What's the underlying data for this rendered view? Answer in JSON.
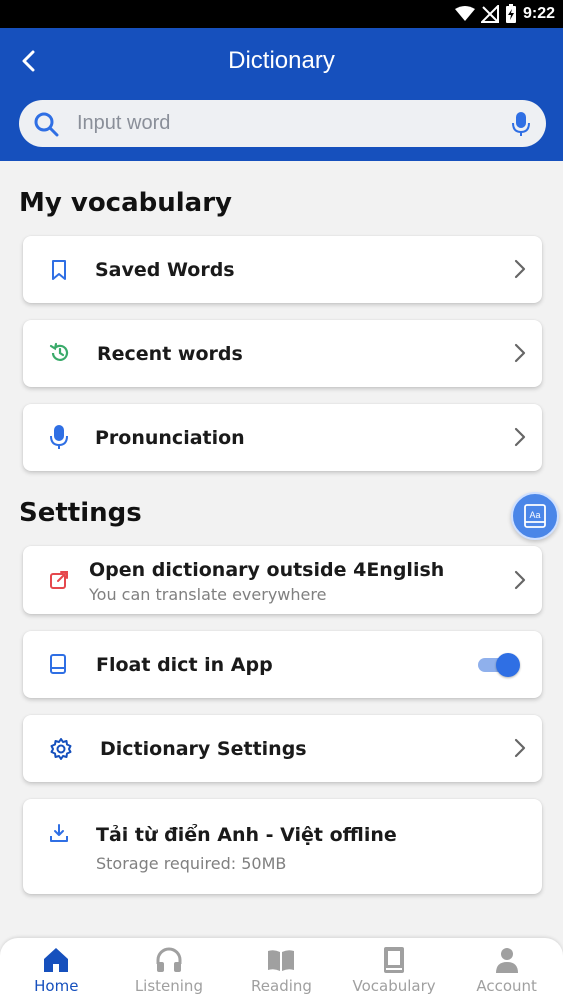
{
  "status_bar": {
    "time": "9:22"
  },
  "header": {
    "title": "Dictionary",
    "search_placeholder": "Input word"
  },
  "my_vocabulary": {
    "title": "My vocabulary",
    "items": [
      {
        "label": "Saved Words",
        "icon": "bookmark-icon"
      },
      {
        "label": "Recent words",
        "icon": "history-icon"
      },
      {
        "label": "Pronunciation",
        "icon": "microphone-icon"
      }
    ]
  },
  "settings": {
    "title": "Settings",
    "open_outside": {
      "label": "Open dictionary outside 4English",
      "sub": "You can translate everywhere",
      "icon": "open-external-icon"
    },
    "float_dict": {
      "label": "Float dict in App",
      "icon": "book-icon",
      "enabled": true
    },
    "dict_settings": {
      "label": "Dictionary Settings",
      "icon": "gear-icon"
    },
    "offline": {
      "label": "Tải từ điển Anh - Việt offline",
      "sub": "Storage required: 50MB",
      "icon": "download-icon"
    }
  },
  "float_button": {
    "text": "Aa"
  },
  "bottom_nav": {
    "items": [
      {
        "label": "Home",
        "icon": "home-icon",
        "active": true
      },
      {
        "label": "Listening",
        "icon": "headphones-icon",
        "active": false
      },
      {
        "label": "Reading",
        "icon": "open-book-icon",
        "active": false
      },
      {
        "label": "Vocabulary",
        "icon": "book-icon",
        "active": false
      },
      {
        "label": "Account",
        "icon": "person-icon",
        "active": false
      }
    ]
  },
  "colors": {
    "primary": "#1650bd",
    "accent_blue": "#2f6fe4",
    "green": "#3aaa6a",
    "red": "#e5484d",
    "inactive": "#a0a0a0"
  }
}
